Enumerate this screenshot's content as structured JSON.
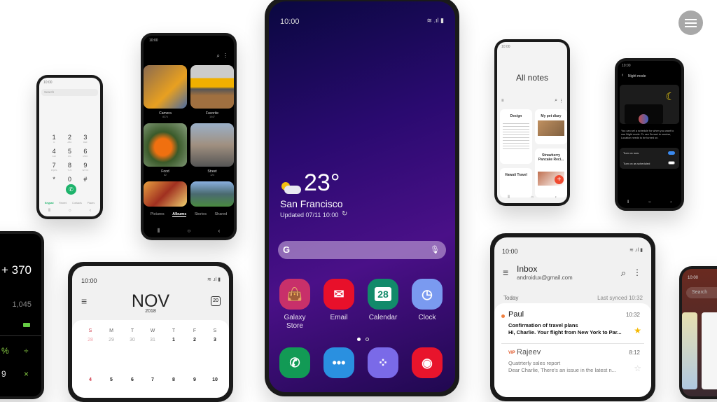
{
  "menu_icon": "hamburger-icon",
  "status_time": "10:00",
  "dialer": {
    "search_placeholder": "Search",
    "keys": [
      [
        "1",
        "ʘ"
      ],
      [
        "2",
        "ABC"
      ],
      [
        "3",
        "DEF"
      ],
      [
        "4",
        "GHI"
      ],
      [
        "5",
        "JKL"
      ],
      [
        "6",
        "MNO"
      ],
      [
        "7",
        "PQRS"
      ],
      [
        "8",
        "TUV"
      ],
      [
        "9",
        "WXYZ"
      ],
      [
        "*",
        ""
      ],
      [
        "0",
        "+"
      ],
      [
        "#",
        ""
      ]
    ],
    "tabs": [
      "Keypad",
      "Recent",
      "Contacts",
      "Places"
    ],
    "accent": "#1db36b"
  },
  "gallery": {
    "albums": [
      {
        "name": "Camera",
        "count": "8374"
      },
      {
        "name": "Favorite",
        "count": "1047"
      },
      {
        "name": "Food",
        "count": "82"
      },
      {
        "name": "Street",
        "count": "124"
      }
    ],
    "tabs": [
      "Pictures",
      "Albums",
      "Stories",
      "Shared"
    ],
    "active_tab": "Albums"
  },
  "home": {
    "weather": {
      "temp": "23°",
      "city": "San Francisco",
      "updated": "Updated 07/11 10:00"
    },
    "apps": [
      {
        "label": "Galaxy Store",
        "color": "#c8306a"
      },
      {
        "label": "Email",
        "color": "#e8102a"
      },
      {
        "label": "Calendar",
        "color": "#128a6a",
        "day": "28"
      },
      {
        "label": "Clock",
        "color": "#7a9af0"
      }
    ],
    "dock": [
      {
        "name": "phone",
        "color": "#129a55"
      },
      {
        "name": "messages",
        "color": "#2a90e0"
      },
      {
        "name": "bixby",
        "color": "#7a6ae8"
      },
      {
        "name": "camera",
        "color": "#e8142c"
      }
    ]
  },
  "notes": {
    "title": "All notes",
    "cards": [
      {
        "title": "Design"
      },
      {
        "title": "My pet diary"
      },
      {
        "title": "Strawberry Pancake Reci..."
      },
      {
        "title": "Hawaii Travel"
      }
    ],
    "fab": "+"
  },
  "night": {
    "title": "Night mode",
    "desc": "You can set a schedule for when you want to use Night mode. To use Sunset to sunrise, Location needs to be turned on.",
    "options": [
      {
        "label": "Turn on now",
        "on": true
      },
      {
        "label": "Turn on as scheduled",
        "on": false
      }
    ]
  },
  "calc": {
    "expr": "+ 370",
    "result": "1,045",
    "keys": [
      "%",
      "÷",
      "9",
      "×"
    ]
  },
  "calendar": {
    "month": "NOV",
    "year": "2018",
    "today": "20",
    "weekdays": [
      "S",
      "M",
      "T",
      "W",
      "T",
      "F",
      "S"
    ],
    "week1": [
      "28",
      "29",
      "30",
      "31",
      "1",
      "2",
      "3"
    ],
    "week2": [
      "4",
      "5",
      "6",
      "7",
      "8",
      "9",
      "10"
    ]
  },
  "email": {
    "title": "Inbox",
    "account": "androidux@gmail.com",
    "section": "Today",
    "synced": "Last synced 10:32",
    "messages": [
      {
        "sender": "Paul",
        "time": "10:32",
        "subject": "Confirmation of travel plans",
        "preview": "Hi, Charlie. Your flight from New York to Par...",
        "starred": true,
        "unread": true
      },
      {
        "vip": "VIP",
        "sender": "Rajeev",
        "time": "8:12",
        "subject": "Quatrterly sales report",
        "preview": "Dear Charlie, There's an issue in the latest n...",
        "starred": false,
        "unread": false
      }
    ]
  },
  "recents": {
    "search": "Search"
  }
}
